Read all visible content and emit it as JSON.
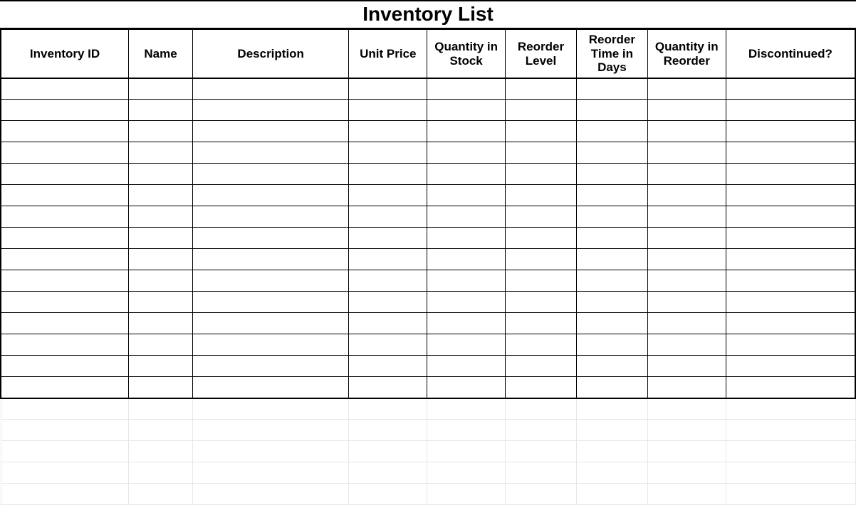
{
  "title": "Inventory List",
  "columns": [
    "Inventory ID",
    "Name",
    "Description",
    "Unit Price",
    "Quantity in Stock",
    "Reorder Level",
    "Reorder Time in Days",
    "Quantity in Reorder",
    "Discontinued?"
  ],
  "dark_row_count": 15,
  "light_row_count": 5,
  "rows": []
}
